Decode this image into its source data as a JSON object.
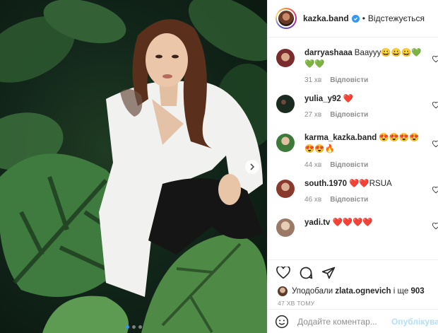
{
  "header": {
    "username": "kazka.band",
    "separator": "•",
    "follow_state": "Відстежується"
  },
  "comments": [
    {
      "user": "darryashaaa",
      "text": "Вааууу😀😀😀💚💚💚",
      "time": "31 хв",
      "reply": "Відповісти",
      "avatar_color": "#7a2b2b"
    },
    {
      "user": "yulia_y92",
      "text": "❤️",
      "time": "27 хв",
      "reply": "Відповісти",
      "avatar_color": "#1b2a1e"
    },
    {
      "user": "karma_kazka.band",
      "text": "😍😍😍😍😍😍🔥",
      "time": "44 хв",
      "reply": "Відповісти",
      "avatar_color": "#3d7a3a"
    },
    {
      "user": "south.1970",
      "text": "❤️❤️RSUA",
      "time": "46 хв",
      "reply": "Відповісти",
      "avatar_color": "#8a3a2c"
    },
    {
      "user": "yadi.tv",
      "text": "❤️❤️❤️❤️",
      "time": "",
      "reply": "",
      "avatar_color": "#9a7a66"
    }
  ],
  "likes": {
    "prefix": "Уподобали",
    "user": "zlata.ognevich",
    "middle": "і ще",
    "count": "903"
  },
  "time_ago": "47 ХВ ТОМУ",
  "add_comment": {
    "placeholder": "Додайте коментар...",
    "post_label": "Опублікува"
  },
  "colors": {
    "accent": "#3897f0",
    "heart": "#ed4956",
    "muted": "#8e8e8e"
  },
  "carousel": {
    "current_slide": 1,
    "total_slides": 3
  }
}
